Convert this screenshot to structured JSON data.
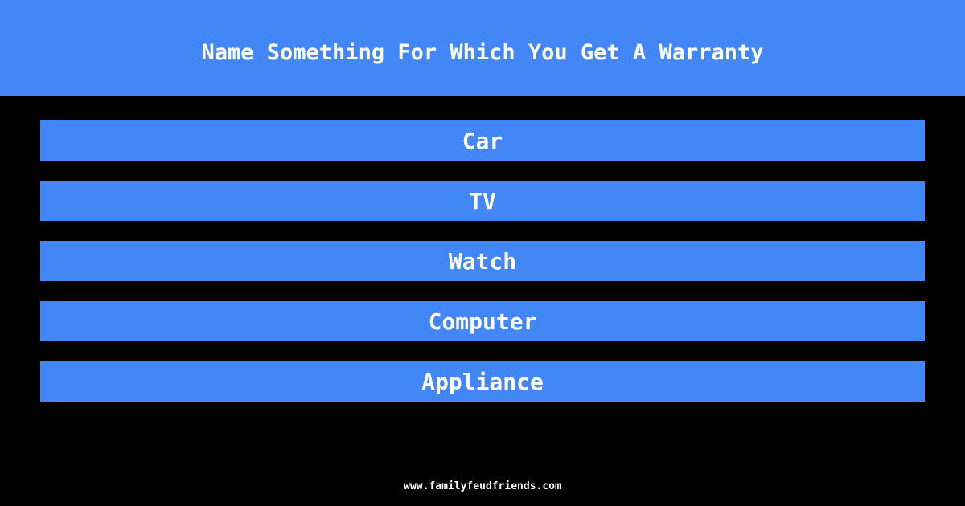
{
  "header": {
    "title": "Name Something For Which You Get A Warranty"
  },
  "answers": [
    {
      "label": "Car"
    },
    {
      "label": "TV"
    },
    {
      "label": "Watch"
    },
    {
      "label": "Computer"
    },
    {
      "label": "Appliance"
    }
  ],
  "footer": {
    "url": "www.familyfeudfriends.com"
  },
  "colors": {
    "accent": "#4287f5",
    "background": "#000000",
    "text": "#ffffff"
  }
}
